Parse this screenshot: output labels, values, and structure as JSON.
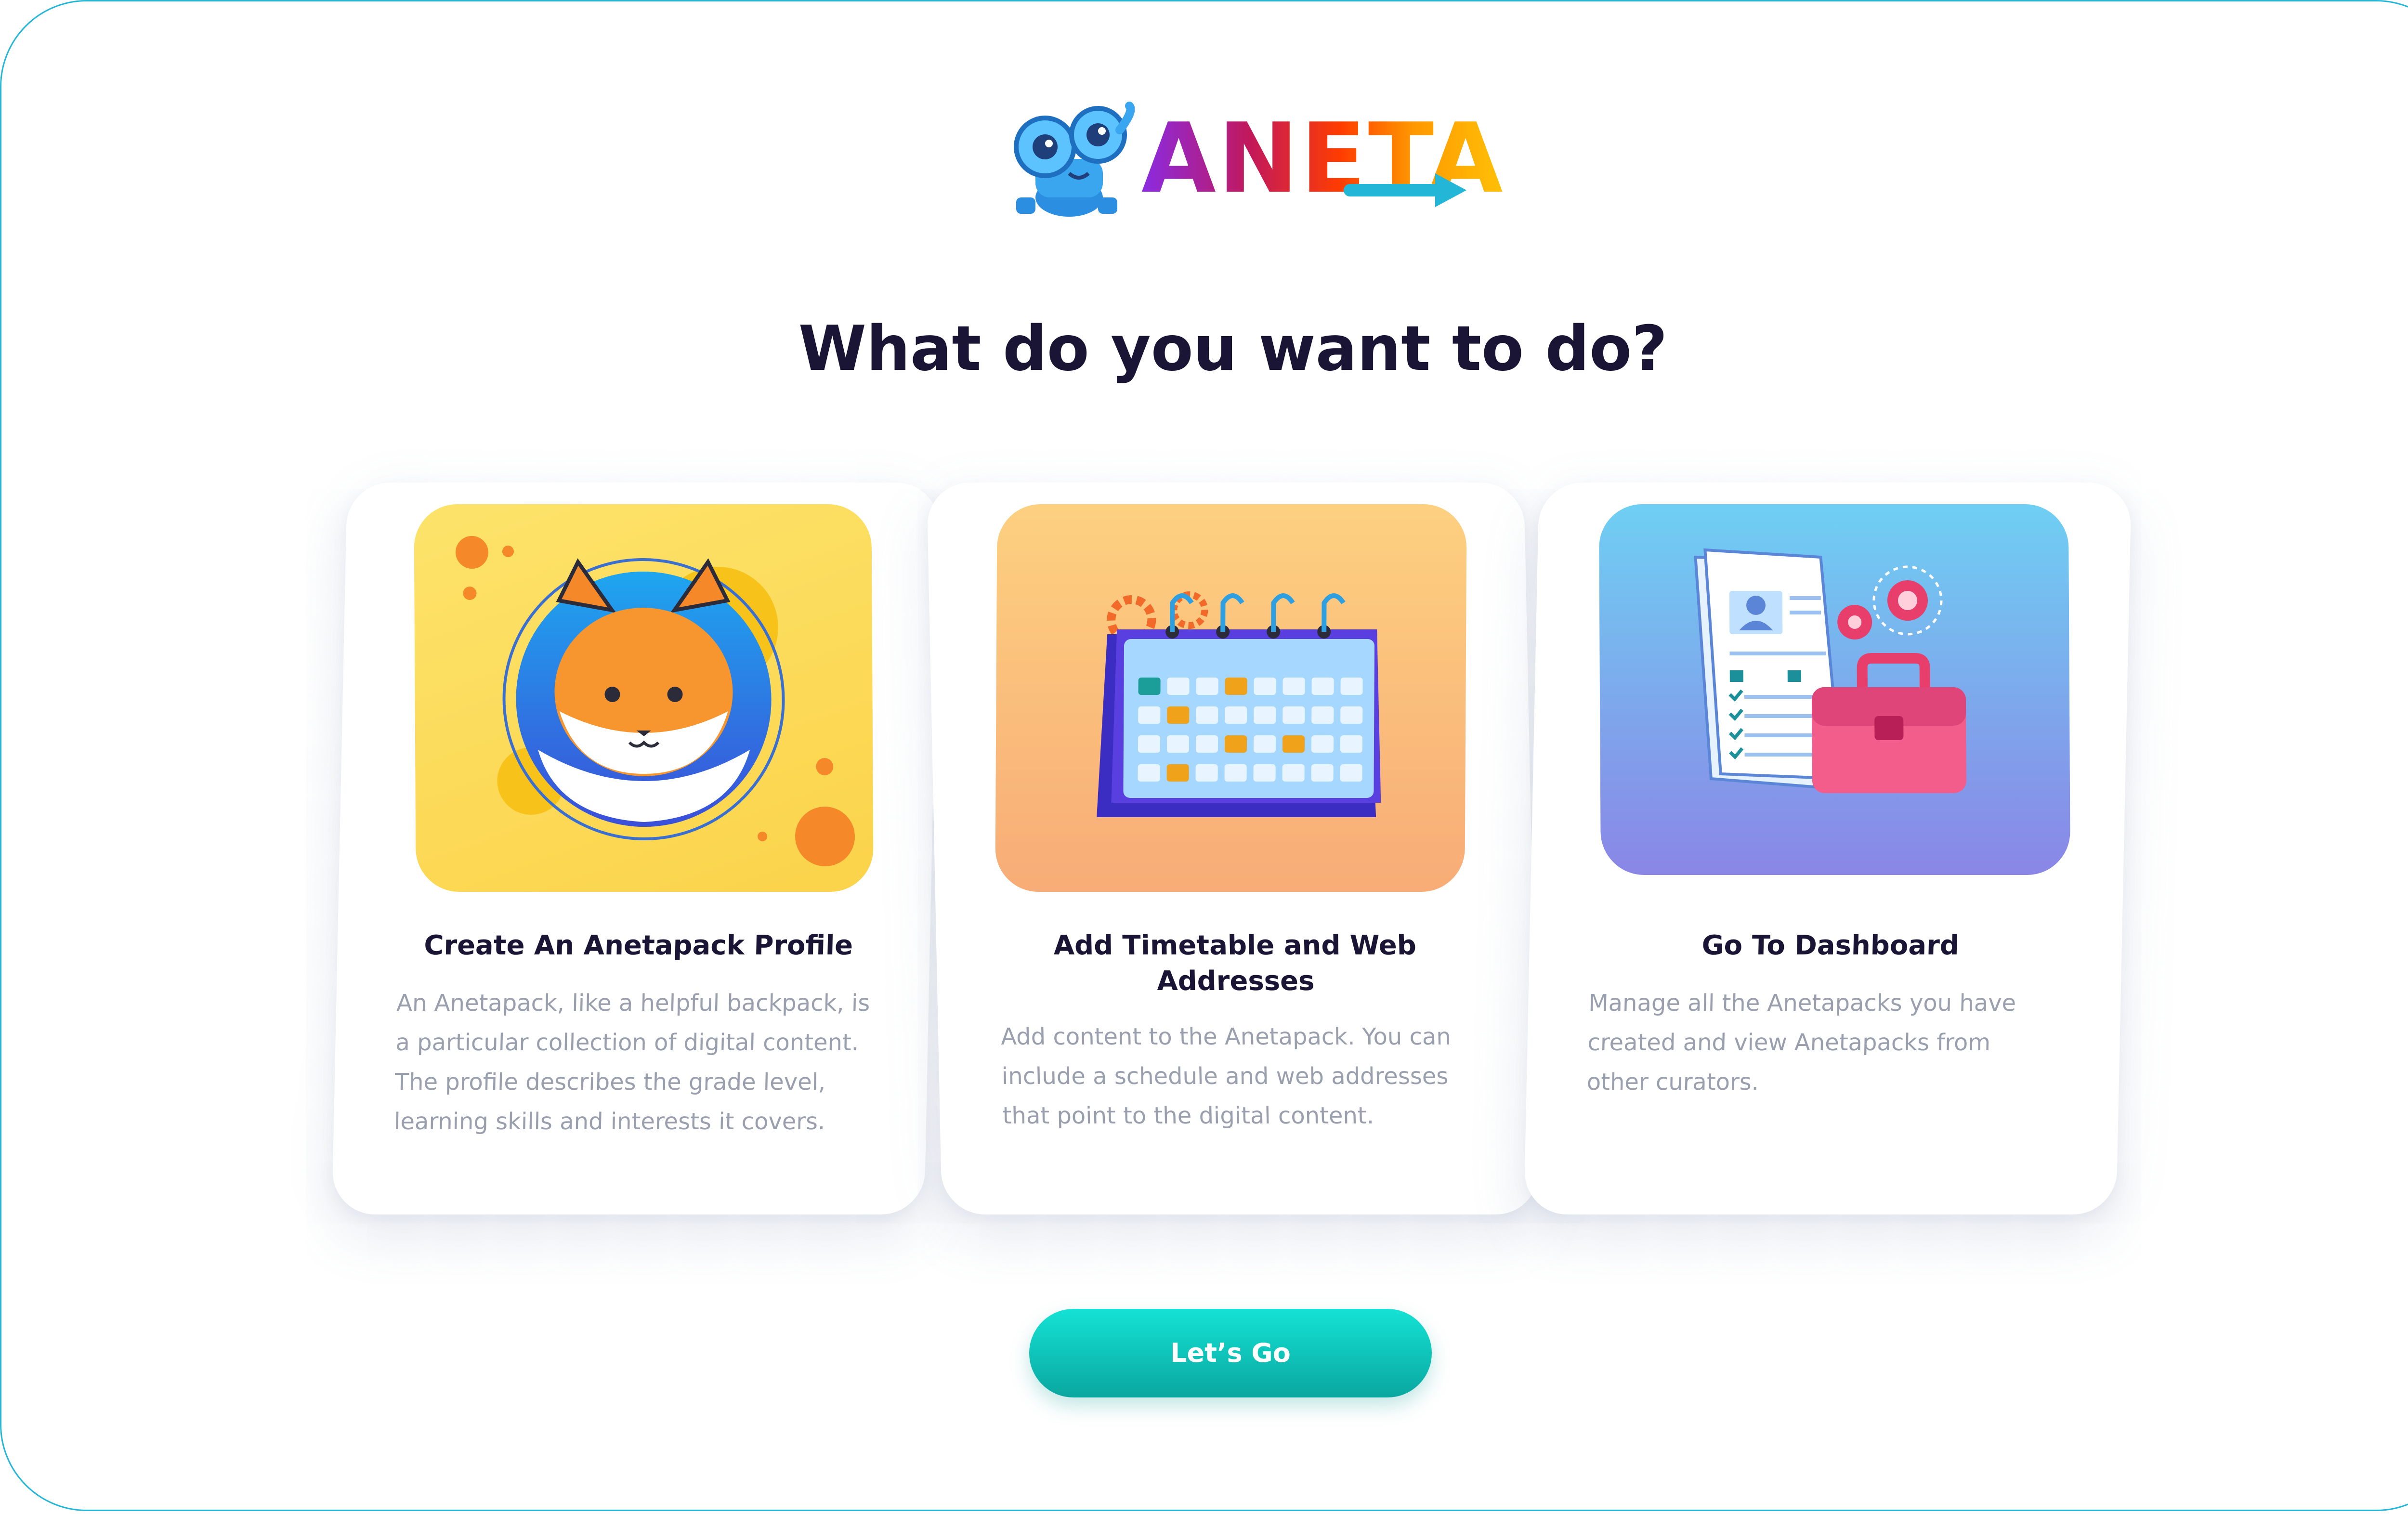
{
  "brand": {
    "name": "ANETA"
  },
  "heading": "What do you want to do?",
  "cards": [
    {
      "title": "Create An Anetapack Profile",
      "description": "An Anetapack, like a helpful backpack, is a particular collection of digital content. The profile describes the grade level, learning skills and interests it covers.",
      "icon": "fox-avatar-icon"
    },
    {
      "title": "Add Timetable and Web Addresses",
      "description": "Add content to the Anetapack. You can include a schedule and web addresses that point to the digital content.",
      "icon": "calendar-icon"
    },
    {
      "title": "Go To Dashboard",
      "description": "Manage all the Anetapacks you have created and view Anetapacks from other curators.",
      "icon": "briefcase-documents-icon"
    }
  ],
  "cta": {
    "label": "Let’s Go"
  },
  "colors": {
    "frame_border": "#23b6d6",
    "heading": "#1b1535",
    "description": "#9a9fae",
    "cta_start": "#14e2d4",
    "cta_end": "#0aa7a0"
  }
}
